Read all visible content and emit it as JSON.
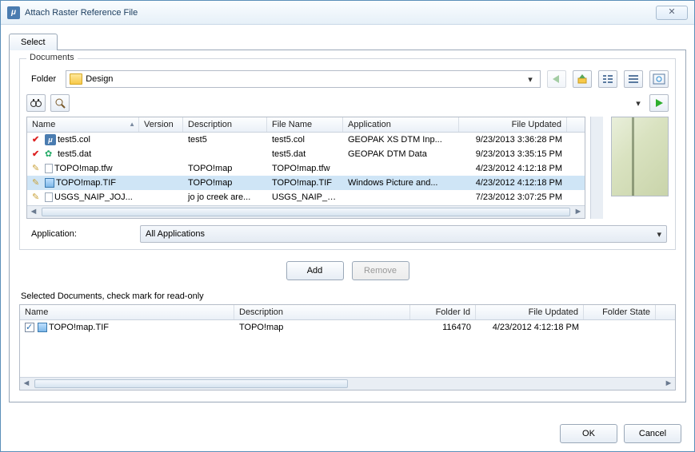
{
  "window": {
    "title": "Attach Raster Reference File"
  },
  "tabs": [
    {
      "label": "Select"
    }
  ],
  "documents": {
    "legend": "Documents",
    "folder_label": "Folder",
    "folder_value": "Design",
    "columns": {
      "name": "Name",
      "version": "Version",
      "description": "Description",
      "filename": "File Name",
      "application": "Application",
      "updated": "File Updated"
    },
    "rows": [
      {
        "status": "checked",
        "typeIcon": "mu",
        "name": "test5.col",
        "version": "",
        "description": "test5",
        "filename": "test5.col",
        "application": "GEOPAK XS DTM Inp...",
        "updated": "9/23/2013 3:36:28 PM",
        "selected": false
      },
      {
        "status": "checked",
        "typeIcon": "gear",
        "name": "test5.dat",
        "version": "",
        "description": "",
        "filename": "test5.dat",
        "application": "GEOPAK DTM Data",
        "updated": "9/23/2013 3:35:15 PM",
        "selected": false
      },
      {
        "status": "pencil",
        "typeIcon": "doc",
        "name": "TOPO!map.tfw",
        "version": "",
        "description": "TOPO!map",
        "filename": "TOPO!map.tfw",
        "application": "",
        "updated": "4/23/2012 4:12:18 PM",
        "selected": false
      },
      {
        "status": "pencil",
        "typeIcon": "pic",
        "name": "TOPO!map.TIF",
        "version": "",
        "description": "TOPO!map",
        "filename": "TOPO!map.TIF",
        "application": "Windows Picture and...",
        "updated": "4/23/2012 4:12:18 PM",
        "selected": true
      },
      {
        "status": "pencil",
        "typeIcon": "doc",
        "name": "USGS_NAIP_JOJ...",
        "version": "",
        "description": "jo jo creek are...",
        "filename": "USGS_NAIP_J...",
        "application": "",
        "updated": "7/23/2012 3:07:25 PM",
        "selected": false
      }
    ]
  },
  "application": {
    "label": "Application:",
    "value": "All Applications"
  },
  "buttons": {
    "add": "Add",
    "remove": "Remove",
    "ok": "OK",
    "cancel": "Cancel"
  },
  "selected": {
    "legend": "Selected Documents, check mark for read-only",
    "columns": {
      "name": "Name",
      "description": "Description",
      "folderid": "Folder Id",
      "updated": "File Updated",
      "state": "Folder State"
    },
    "rows": [
      {
        "checked": true,
        "typeIcon": "pic",
        "name": "TOPO!map.TIF",
        "description": "TOPO!map",
        "folderid": "116470",
        "updated": "4/23/2012 4:12:18 PM",
        "state": ""
      }
    ]
  }
}
